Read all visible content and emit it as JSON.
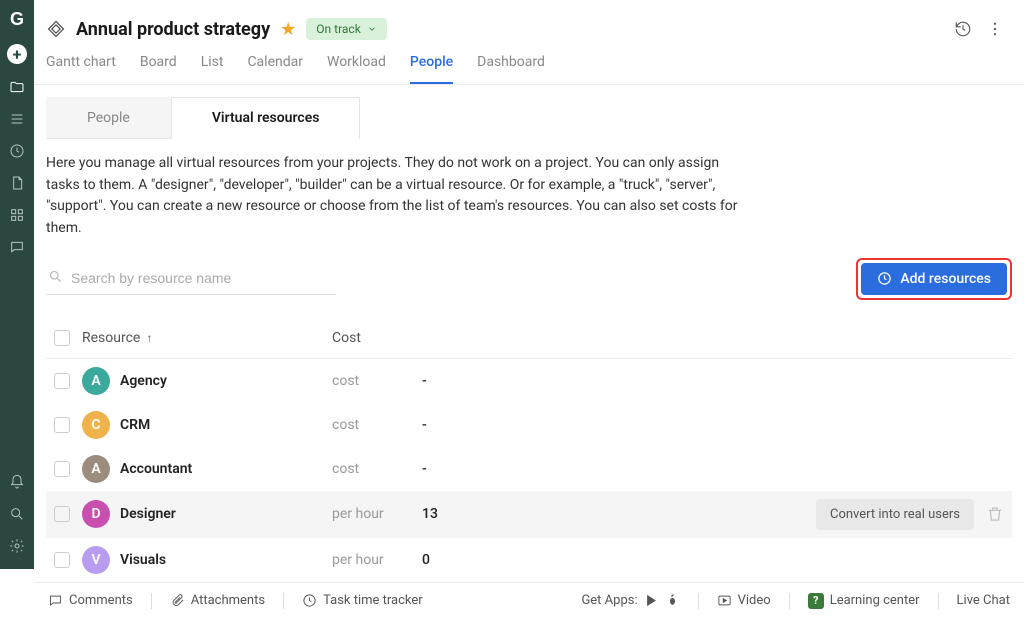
{
  "header": {
    "title": "Annual product strategy",
    "status": "On track"
  },
  "tabs": [
    {
      "label": "Gantt chart",
      "active": false
    },
    {
      "label": "Board",
      "active": false
    },
    {
      "label": "List",
      "active": false
    },
    {
      "label": "Calendar",
      "active": false
    },
    {
      "label": "Workload",
      "active": false
    },
    {
      "label": "People",
      "active": true
    },
    {
      "label": "Dashboard",
      "active": false
    }
  ],
  "subtabs": {
    "people": "People",
    "virtual": "Virtual resources"
  },
  "description": "Here you manage all virtual resources from your projects. They do not work on a project. You can only assign tasks to them. A \"designer\", \"developer\", \"builder\" can be a virtual resource. Or for example, a \"truck\", \"server\", \"support\". You can create a new resource or choose from the list of team's resources. You can also set costs for them.",
  "search": {
    "placeholder": "Search by resource name"
  },
  "add_button": "Add resources",
  "columns": {
    "resource": "Resource",
    "cost": "Cost"
  },
  "rows": [
    {
      "initial": "A",
      "name": "Agency",
      "cost": "cost",
      "value": "-",
      "color": "#3ba99c",
      "hover": false
    },
    {
      "initial": "C",
      "name": "CRM",
      "cost": "cost",
      "value": "-",
      "color": "#f0b24a",
      "hover": false
    },
    {
      "initial": "A",
      "name": "Accountant",
      "cost": "cost",
      "value": "-",
      "color": "#9c8c7d",
      "hover": false
    },
    {
      "initial": "D",
      "name": "Designer",
      "cost": "per hour",
      "value": "13",
      "color": "#c94fae",
      "hover": true
    },
    {
      "initial": "V",
      "name": "Visuals",
      "cost": "per hour",
      "value": "0",
      "color": "#b89cf0",
      "hover": false
    }
  ],
  "row_actions": {
    "convert": "Convert into real users"
  },
  "footer": {
    "comments": "Comments",
    "attachments": "Attachments",
    "tracker": "Task time tracker",
    "get_apps": "Get Apps:",
    "video": "Video",
    "learning": "Learning center",
    "chat": "Live Chat"
  }
}
